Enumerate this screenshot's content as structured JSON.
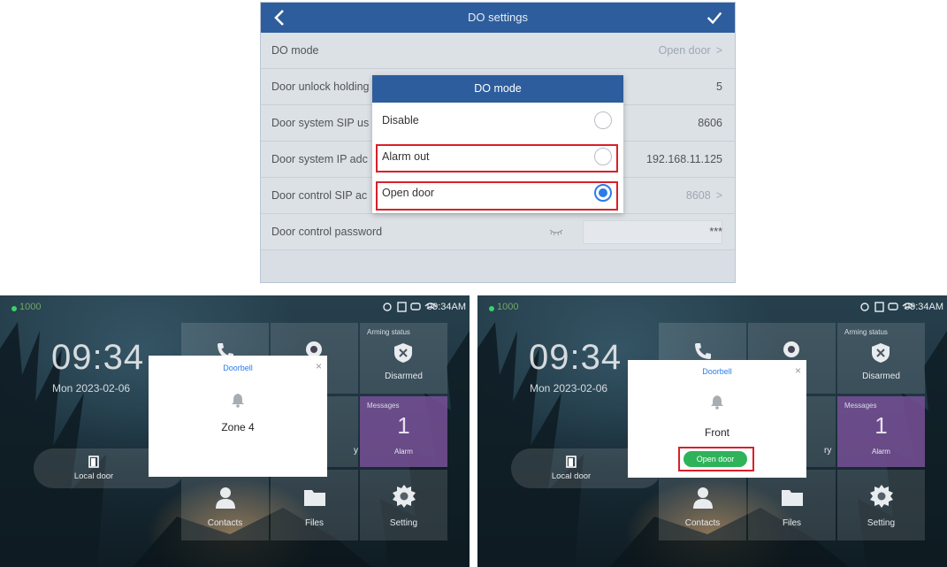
{
  "settings": {
    "title": "DO settings",
    "rows": [
      {
        "label": "DO mode",
        "value": "Open door",
        "chevron": ">"
      },
      {
        "label": "Door unlock holding",
        "value": "5"
      },
      {
        "label": "Door system SIP us",
        "value": "8606"
      },
      {
        "label": "Door system IP adc",
        "value": "192.168.11.125"
      },
      {
        "label": "Door control SIP ac",
        "value": "8608",
        "chevron": ">"
      },
      {
        "label": "Door control password",
        "value": "***"
      }
    ],
    "dialog": {
      "title": "DO mode",
      "options": [
        {
          "label": "Disable",
          "selected": false
        },
        {
          "label": "Alarm out",
          "selected": false
        },
        {
          "label": "Open door",
          "selected": true
        }
      ]
    },
    "colors": {
      "header": "#2d5d9c",
      "highlight": "#d8202a",
      "radio_on": "#2d7be6"
    }
  },
  "left_screen": {
    "status": {
      "number": "1000",
      "time": "09:34AM"
    },
    "clock": "09:34",
    "date": "Mon 2023-02-06",
    "local_door": "Local door",
    "arming_status": "Arming status",
    "disarmed": "Disarmed",
    "messages_tag": "Messages",
    "messages_count": "1",
    "alarm": "Alarm",
    "contacts": "Contacts",
    "files": "Files",
    "setting": "Setting",
    "partial_label": "y",
    "popup": {
      "title": "Doorbell",
      "close": "×",
      "name": "Zone 4"
    }
  },
  "right_screen": {
    "status": {
      "number": "1000",
      "time": "09:34AM"
    },
    "clock": "09:34",
    "date": "Mon 2023-02-06",
    "local_door": "Local door",
    "arming_status": "Arming status",
    "disarmed": "Disarmed",
    "messages_tag": "Messages",
    "messages_count": "1",
    "alarm": "Alarm",
    "contacts": "Contacts",
    "files": "Files",
    "setting": "Setting",
    "partial_label": "ry",
    "popup": {
      "title": "Doorbell",
      "close": "×",
      "name": "Front",
      "button": "Open door"
    }
  },
  "icons": [
    "back-chevron-icon",
    "check-icon",
    "eye-closed-icon",
    "bell-icon",
    "door-icon",
    "phone-icon",
    "camera-icon",
    "shield-x-icon",
    "message-icon",
    "contacts-icon",
    "folder-icon",
    "gear-icon"
  ]
}
